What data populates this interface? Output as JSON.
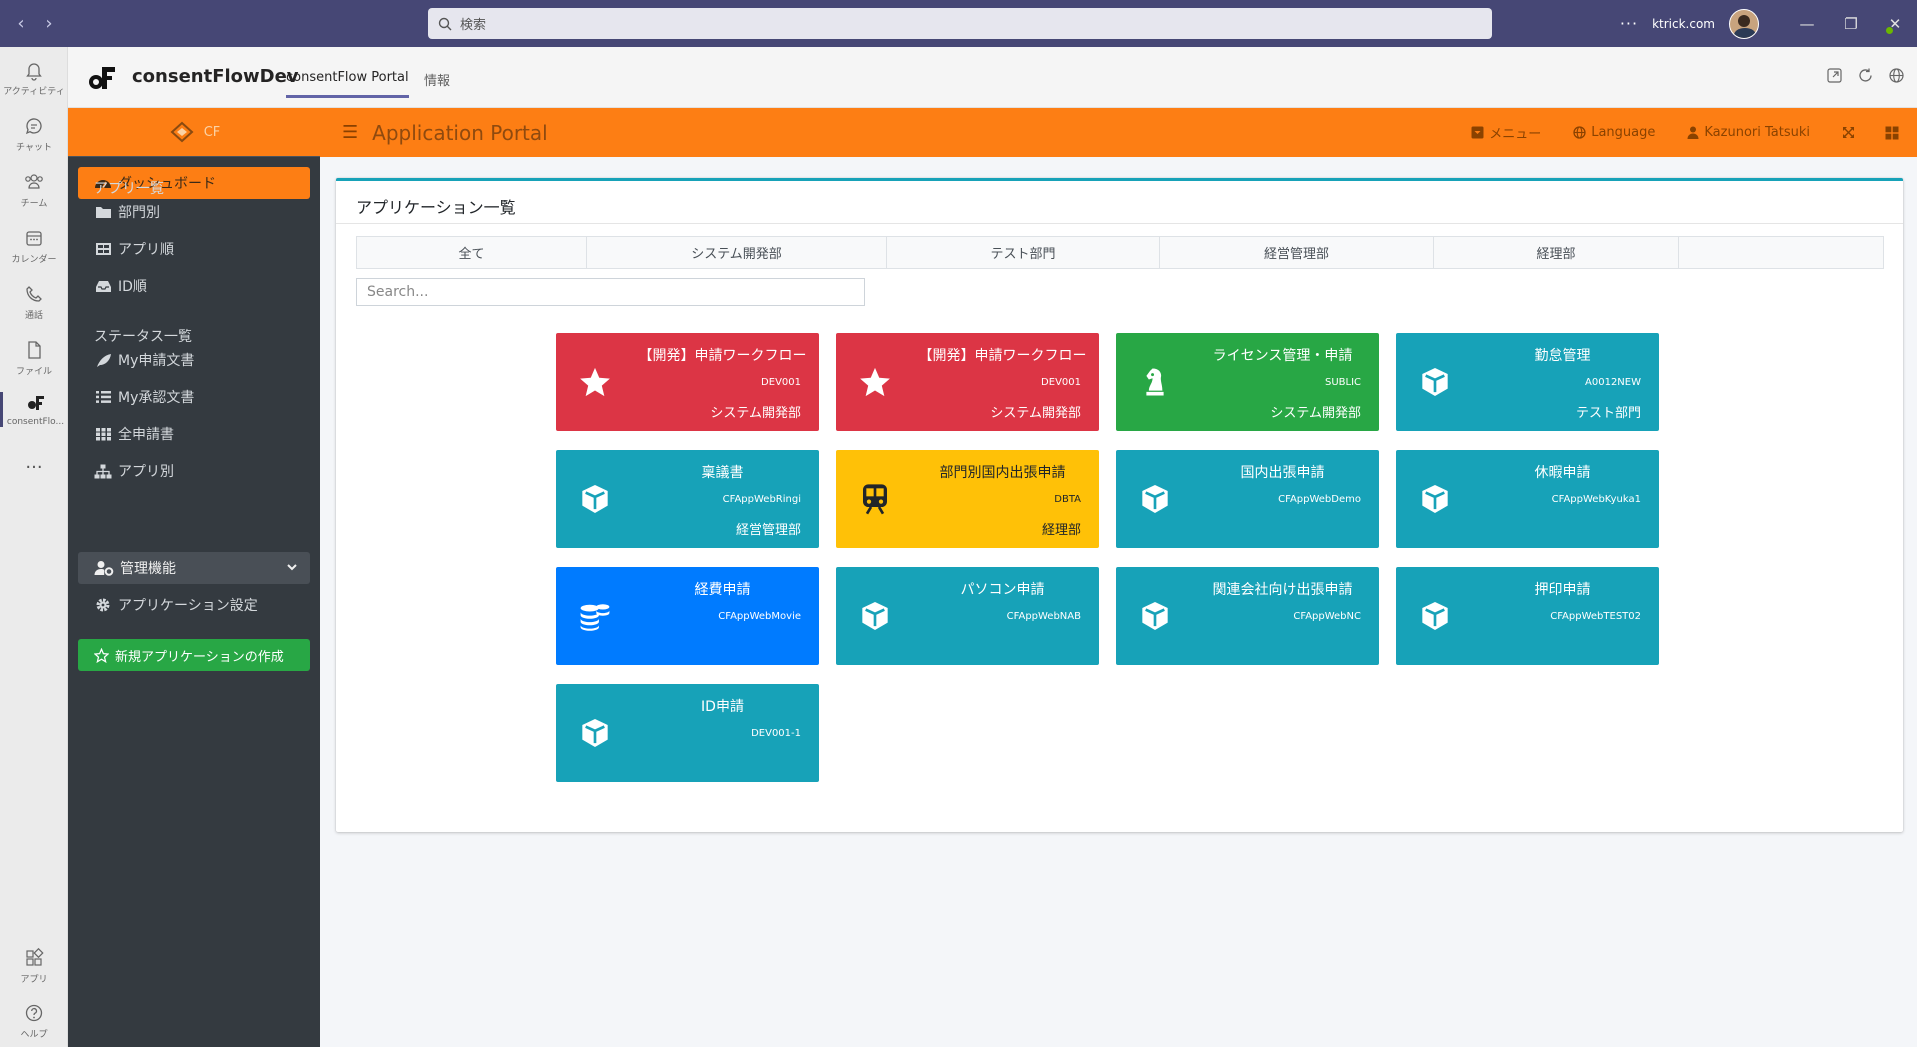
{
  "titlebar": {
    "search_placeholder": "検索",
    "dots": "···",
    "org": "ktrick.com"
  },
  "rail": {
    "items": [
      {
        "label": "アクティビティ",
        "icon": "bell-icon"
      },
      {
        "label": "チャット",
        "icon": "chat-icon"
      },
      {
        "label": "チーム",
        "icon": "teams-icon"
      },
      {
        "label": "カレンダー",
        "icon": "calendar-icon"
      },
      {
        "label": "通話",
        "icon": "phone-icon"
      },
      {
        "label": "ファイル",
        "icon": "file-icon"
      },
      {
        "label": "consentFlo...",
        "icon": "consentflow-icon"
      }
    ],
    "more": "···",
    "bottom": [
      {
        "label": "アプリ",
        "icon": "apps-icon"
      },
      {
        "label": "ヘルプ",
        "icon": "help-icon"
      }
    ]
  },
  "appheader": {
    "name": "consentFlowDev",
    "tabs": [
      {
        "label": "consentFlow Portal",
        "active": true
      },
      {
        "label": "情報",
        "active": false
      }
    ]
  },
  "topbar": {
    "title": "Application Portal",
    "menu": "メニュー",
    "language": "Language",
    "user": "Kazunori Tatsuki"
  },
  "sidebar": {
    "brand": "CF",
    "dashboard": "ダッシュボード",
    "app_list_header": "アプリ一覧",
    "app_list": [
      {
        "label": "部門別",
        "icon": "folder-icon"
      },
      {
        "label": "アプリ順",
        "icon": "grid-table-icon"
      },
      {
        "label": "ID順",
        "icon": "inbox-icon"
      }
    ],
    "status_header": "ステータス一覧",
    "status_list": [
      {
        "label": "My申請文書",
        "icon": "feather-icon"
      },
      {
        "label": "My承認文書",
        "icon": "list-icon"
      },
      {
        "label": "全申請書",
        "icon": "th-icon"
      },
      {
        "label": "アプリ別",
        "icon": "sitemap-icon"
      }
    ],
    "admin": "管理機能",
    "app_settings": "アプリケーション設定",
    "new_app": "新規アプリケーションの作成"
  },
  "card": {
    "title": "アプリケーション一覧",
    "filters": [
      "全て",
      "システム開発部",
      "テスト部門",
      "経営管理部",
      "経理部",
      ""
    ],
    "search_placeholder": "Search..."
  },
  "tiles": [
    {
      "title": "【開発】申請ワークフロー",
      "code": "DEV001",
      "dept": "システム開発部",
      "color": "#dc3545",
      "icon": "star-icon"
    },
    {
      "title": "【開発】申請ワークフロー",
      "code": "DEV001",
      "dept": "システム開発部",
      "color": "#dc3545",
      "icon": "star-icon"
    },
    {
      "title": "ライセンス管理・申請",
      "code": "SUBLIC",
      "dept": "システム開発部",
      "color": "#28a745",
      "icon": "chess-knight-icon"
    },
    {
      "title": "勤怠管理",
      "code": "A0012NEW",
      "dept": "テスト部門",
      "color": "#17a2b8",
      "icon": "cube-icon"
    },
    {
      "title": "稟議書",
      "code": "CFAppWebRingi",
      "dept": "経営管理部",
      "color": "#17a2b8",
      "icon": "cube-icon"
    },
    {
      "title": "部門別国内出張申請",
      "code": "DBTA",
      "dept": "経理部",
      "color": "#ffc107",
      "icon": "subway-icon"
    },
    {
      "title": "国内出張申請",
      "code": "CFAppWebDemo",
      "dept": "",
      "color": "#17a2b8",
      "icon": "cube-icon"
    },
    {
      "title": "休暇申請",
      "code": "CFAppWebKyuka1",
      "dept": "",
      "color": "#17a2b8",
      "icon": "cube-icon"
    },
    {
      "title": "経費申請",
      "code": "CFAppWebMovie",
      "dept": "",
      "color": "#007bff",
      "icon": "coins-icon"
    },
    {
      "title": "パソコン申請",
      "code": "CFAppWebNAB",
      "dept": "",
      "color": "#17a2b8",
      "icon": "cube-icon"
    },
    {
      "title": "関連会社向け出張申請",
      "code": "CFAppWebNC",
      "dept": "",
      "color": "#17a2b8",
      "icon": "cube-icon"
    },
    {
      "title": "押印申請",
      "code": "CFAppWebTEST02",
      "dept": "",
      "color": "#17a2b8",
      "icon": "cube-icon"
    },
    {
      "title": "ID申請",
      "code": "DEV001-1",
      "dept": "",
      "color": "#17a2b8",
      "icon": "cube-icon"
    }
  ]
}
